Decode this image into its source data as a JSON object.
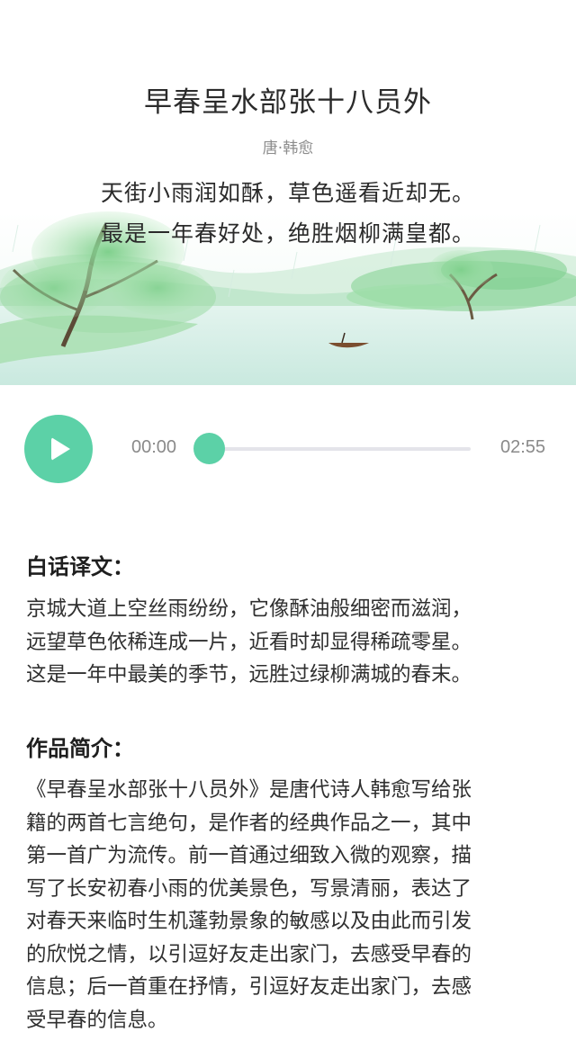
{
  "poem": {
    "title": "早春呈水部张十八员外",
    "author": "唐·韩愈",
    "lines": [
      "天街小雨润如酥，草色遥看近却无。",
      "最是一年春好处，绝胜烟柳满皇都。"
    ]
  },
  "player": {
    "current_time": "00:00",
    "total_time": "02:55",
    "progress": 0.0,
    "accent_color": "#5cd1a7",
    "play_icon": "play-icon"
  },
  "translation": {
    "heading": "白话译文：",
    "lines": [
      "京城大道上空丝雨纷纷，它像酥油般细密而滋润，",
      "远望草色依稀连成一片，近看时却显得稀疏零星。",
      "这是一年中最美的季节，远胜过绿柳满城的春末。"
    ]
  },
  "intro": {
    "heading": "作品简介：",
    "lines": [
      "《早春呈水部张十八员外》是唐代诗人韩愈写给张",
      "籍的两首七言绝句，是作者的经典作品之一，其中",
      "第一首广为流传。前一首通过细致入微的观察，描",
      "写了长安初春小雨的优美景色，写景清丽，表达了",
      "对春天来临时生机蓬勃景象的敏感以及由此而引发",
      "的欣悦之情，以引逗好友走出家门，去感受早春的",
      "信息；后一首重在抒情，引逗好友走出家门，去感",
      "受早春的信息。"
    ]
  }
}
